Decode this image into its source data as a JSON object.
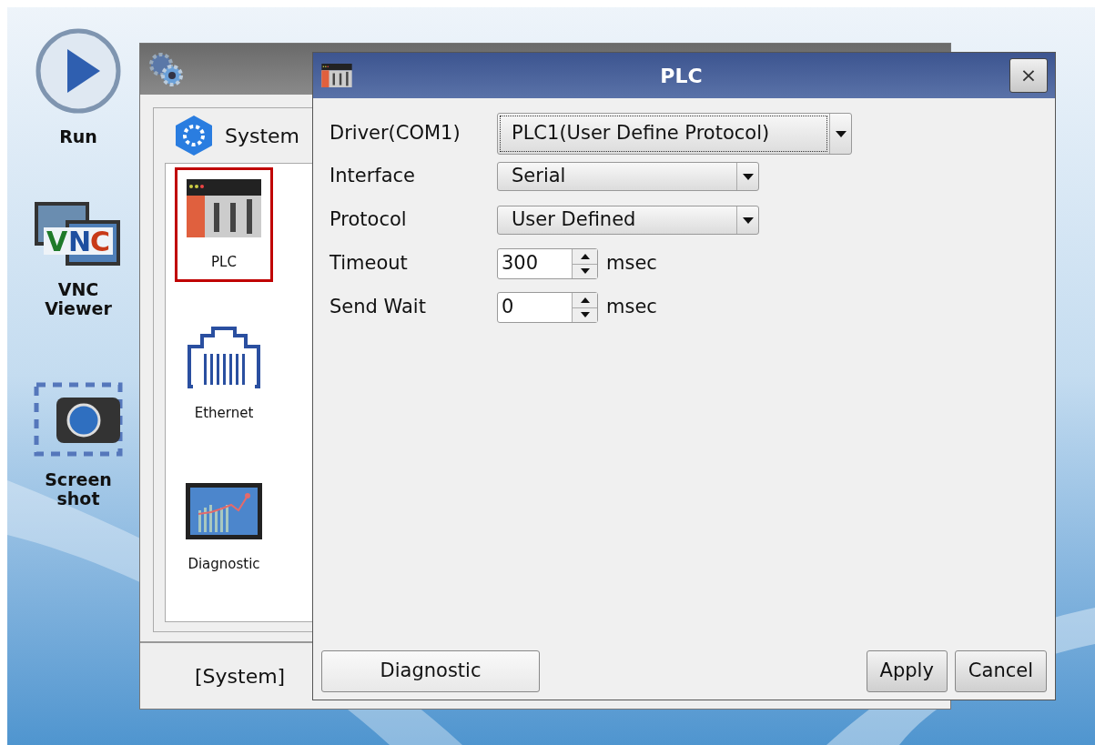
{
  "sidebar": [
    {
      "label": "Run"
    },
    {
      "label": "VNC Viewer",
      "logo": [
        {
          "letter": "V",
          "color": "#1f7a2a"
        },
        {
          "letter": "N",
          "color": "#1d4fa0"
        },
        {
          "letter": "C",
          "color": "#c83a18"
        }
      ]
    },
    {
      "label": "Screen shot"
    }
  ],
  "system_window": {
    "heading": "System",
    "items": [
      {
        "label": "PLC",
        "selected": true
      },
      {
        "label": "Ethernet",
        "selected": false
      },
      {
        "label": "Diagnostic",
        "selected": false
      }
    ],
    "footer": "[System]"
  },
  "dialog": {
    "title": "PLC",
    "close": "×",
    "fields": [
      {
        "kind": "dropdown",
        "label": "Driver(COM1)",
        "value": "PLC1(User Define Protocol)",
        "focused": true
      },
      {
        "kind": "dropdown",
        "label": "Interface",
        "value": "Serial",
        "focused": false
      },
      {
        "kind": "dropdown",
        "label": "Protocol",
        "value": "User Defined",
        "focused": false
      },
      {
        "kind": "spinner",
        "label": "Timeout",
        "value": "300",
        "unit": "msec"
      },
      {
        "kind": "spinner",
        "label": "Send Wait",
        "value": "0",
        "unit": "msec"
      }
    ],
    "buttons": [
      {
        "label": "Diagnostic",
        "kind": "left"
      },
      {
        "label": "Apply",
        "kind": "right"
      },
      {
        "label": "Cancel",
        "kind": "right"
      }
    ]
  }
}
